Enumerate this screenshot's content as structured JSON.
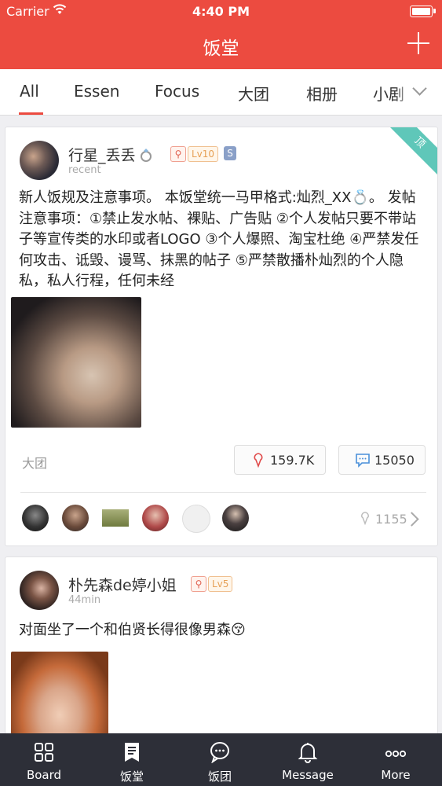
{
  "status": {
    "carrier": "Carrier",
    "time": "4:40 PM"
  },
  "header": {
    "title": "饭堂"
  },
  "tabs": [
    "All",
    "Essen",
    "Focus",
    "大团",
    "相册",
    "小剧"
  ],
  "posts": [
    {
      "user": "行星_丢丢",
      "time": "recent",
      "badges": {
        "level": "Lv10",
        "s": "S"
      },
      "corner": "顶",
      "text": "新人饭规及注意事项。  本饭堂统一马甲格式:灿烈_XX💍。  发帖注意事项：①禁止发水帖、裸贴、广告贴 ②个人发帖只要不带站子等宣传类的水印或者LOGO ③个人爆照、淘宝杜绝 ④严禁发任何攻击、诋毁、谩骂、抹黑的帖子 ⑤严禁散播朴灿烈的个人隐私，私人行程，任何未经",
      "tag": "大团",
      "likes": "159.7K",
      "comments": "15050",
      "liker_count": "1155"
    },
    {
      "user": "朴先森de婷小姐",
      "time": "44min",
      "badges": {
        "level": "Lv5"
      },
      "text": "对面坐了一个和伯贤长得很像男森😚"
    }
  ],
  "tabbar": [
    "Board",
    "饭堂",
    "饭团",
    "Message",
    "More"
  ],
  "colors": {
    "accent": "#ec4b40",
    "tabbar": "#2d2f38",
    "pin": "#5fc7b9"
  }
}
